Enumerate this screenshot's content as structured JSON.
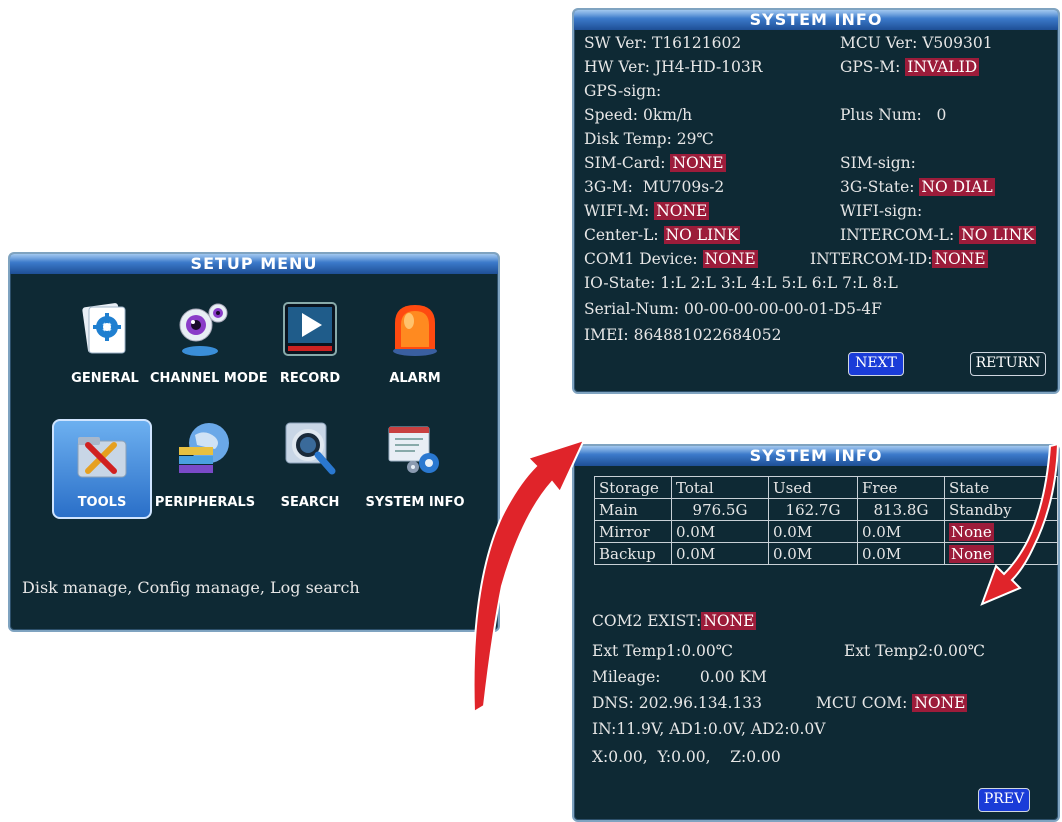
{
  "setup_menu": {
    "title": "SETUP  MENU",
    "items": [
      {
        "label": "GENERAL",
        "icon": "general-settings-icon"
      },
      {
        "label": "CHANNEL MODE",
        "icon": "webcam-icon"
      },
      {
        "label": "RECORD",
        "icon": "play-icon"
      },
      {
        "label": "ALARM",
        "icon": "alarm-siren-icon"
      },
      {
        "label": "TOOLS",
        "icon": "tools-icon",
        "selected": true
      },
      {
        "label": "PERIPHERALS",
        "icon": "peripherals-icon"
      },
      {
        "label": "SEARCH",
        "icon": "search-icon"
      },
      {
        "label": "SYSTEM INFO",
        "icon": "system-info-icon"
      }
    ],
    "description": "Disk manage, Config manage, Log search"
  },
  "system_info_1": {
    "title": "SYSTEM  INFO",
    "sw_ver": "SW Ver: T16121602",
    "mcu_ver": "MCU Ver: V509301",
    "hw_ver": "HW Ver: JH4-HD-103R",
    "gps_m_label": "GPS-M: ",
    "gps_m_value": "INVALID",
    "gps_sign": "GPS-sign:",
    "speed": "Speed: 0km/h",
    "plus_num": "Plus Num:   0",
    "disk_temp": "Disk Temp: 29℃",
    "sim_card_label": "SIM-Card: ",
    "sim_card_value": "NONE",
    "sim_sign": "SIM-sign:",
    "g3_m": "3G-M:  MU709s-2",
    "g3_state_label": "3G-State: ",
    "g3_state_value": "NO DIAL",
    "wifi_m_label": "WIFI-M: ",
    "wifi_m_value": "NONE",
    "wifi_sign": "WIFI-sign:",
    "center_l_label": "Center-L: ",
    "center_l_value": "NO LINK",
    "intercom_l_label": "INTERCOM-L: ",
    "intercom_l_value": "NO LINK",
    "com1_label": "COM1 Device: ",
    "com1_value": "NONE",
    "intercom_id_label": "INTERCOM-ID:",
    "intercom_id_value": "NONE",
    "io_state": "IO-State: 1:L 2:L 3:L 4:L 5:L 6:L 7:L 8:L",
    "serial_num": "Serial-Num: 00-00-00-00-00-01-D5-4F",
    "imei": "IMEI: 864881022684052",
    "next_label": "NEXT",
    "return_label": "RETURN"
  },
  "system_info_2": {
    "title": "SYSTEM  INFO",
    "storage_table": {
      "headers": [
        "Storage",
        "Total",
        "Used",
        "Free",
        "State"
      ],
      "rows": [
        [
          "Main",
          "976.5G",
          "162.7G",
          "813.8G",
          "Standby"
        ],
        [
          "Mirror",
          "0.0M",
          "0.0M",
          "0.0M",
          "None"
        ],
        [
          "Backup",
          "0.0M",
          "0.0M",
          "0.0M",
          "None"
        ]
      ]
    },
    "com2_label": "COM2 EXIST:",
    "com2_value": "NONE",
    "ext_temp1": "Ext Temp1:0.00℃",
    "ext_temp2": "Ext Temp2:0.00℃",
    "mileage": "Mileage:        0.00 KM",
    "dns": "DNS: 202.96.134.133",
    "mcu_com_label": "MCU COM: ",
    "mcu_com_value": "NONE",
    "voltages": "IN:11.9V, AD1:0.0V, AD2:0.0V",
    "xyz": "X:0.00,  Y:0.00,    Z:0.00",
    "prev_label": "PREV"
  },
  "colors": {
    "panel_bg": "#0e2934",
    "title_bar": "#3a78c8",
    "highlight": "#9c1c3a",
    "button_blue": "#1a3cd8",
    "arrow_red": "#e0242a"
  }
}
